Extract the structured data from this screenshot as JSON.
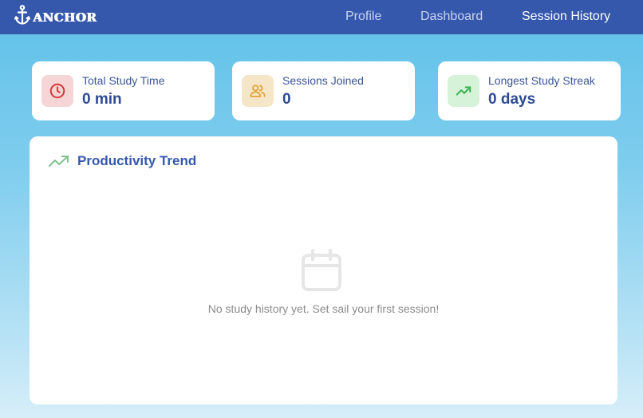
{
  "navbar": {
    "logo_text": "ANCHOR",
    "links": [
      {
        "label": "Profile",
        "active": false
      },
      {
        "label": "Dashboard",
        "active": false
      },
      {
        "label": "Session History",
        "active": true
      }
    ]
  },
  "stats": [
    {
      "label": "Total Study Time",
      "value": "0 min",
      "icon": "clock-icon",
      "icon_bg": "#f5d5d5",
      "icon_color": "#d63a3a"
    },
    {
      "label": "Sessions Joined",
      "value": "0",
      "icon": "users-icon",
      "icon_bg": "#f5e6c8",
      "icon_color": "#e0a43a"
    },
    {
      "label": "Longest Study Streak",
      "value": "0 days",
      "icon": "trending-up-icon",
      "icon_bg": "#d6f2d8",
      "icon_color": "#3db352"
    }
  ],
  "trend": {
    "title": "Productivity Trend",
    "empty_icon": "calendar-icon",
    "empty_message": "No study history yet. Set sail your first session!"
  },
  "colors": {
    "navbar": "#3558ad",
    "accent": "#3558ad",
    "trend_icon": "#7fc18f"
  }
}
